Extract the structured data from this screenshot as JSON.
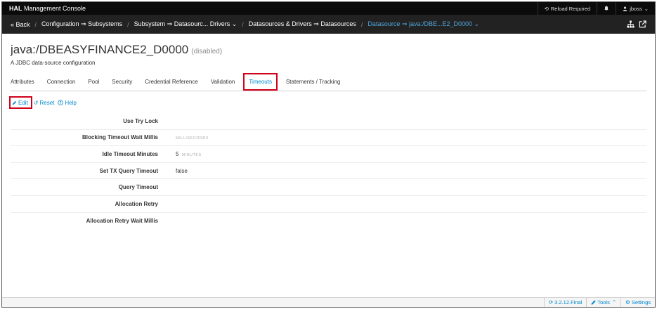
{
  "topbar": {
    "brand_bold": "HAL",
    "brand_rest": " Management Console",
    "reload_label": "Reload Required",
    "user_label": "jboss"
  },
  "breadcrumb": {
    "back": "« Back",
    "items": [
      "Configuration ⇒ Subsystems",
      "Subsystem ⇒ Datasourc... Drivers ⌄",
      "Datasources & Drivers ⇒ Datasources",
      "Datasource ⇒ java:/DBE...E2_D0000 ⌄"
    ]
  },
  "header": {
    "title": "java:/DBEASYFINANCE2_D0000",
    "status": "(disabled)",
    "description": "A JDBC data-source configuration"
  },
  "tabs": [
    "Attributes",
    "Connection",
    "Pool",
    "Security",
    "Credential Reference",
    "Validation",
    "Timeouts",
    "Statements / Tracking"
  ],
  "active_tab": "Timeouts",
  "toolbar": {
    "edit": "Edit",
    "reset": "Reset",
    "help": "Help"
  },
  "form": {
    "rows": [
      {
        "label": "Use Try Lock",
        "value": "",
        "unit": ""
      },
      {
        "label": "Blocking Timeout Wait Millis",
        "value": "",
        "unit": "MILLISECONDS"
      },
      {
        "label": "Idle Timeout Minutes",
        "value": "5",
        "unit": "MINUTES"
      },
      {
        "label": "Set TX Query Timeout",
        "value": "false",
        "unit": ""
      },
      {
        "label": "Query Timeout",
        "value": "",
        "unit": ""
      },
      {
        "label": "Allocation Retry",
        "value": "",
        "unit": ""
      },
      {
        "label": "Allocation Retry Wait Millis",
        "value": "",
        "unit": ""
      }
    ]
  },
  "footer": {
    "version": "3.2.12.Final",
    "tools": "Tools",
    "settings": "Settings"
  },
  "colors": {
    "accent": "#0088ce",
    "highlight": "#d0021b",
    "topbar": "#0b0b0b",
    "navbar": "#222222"
  }
}
